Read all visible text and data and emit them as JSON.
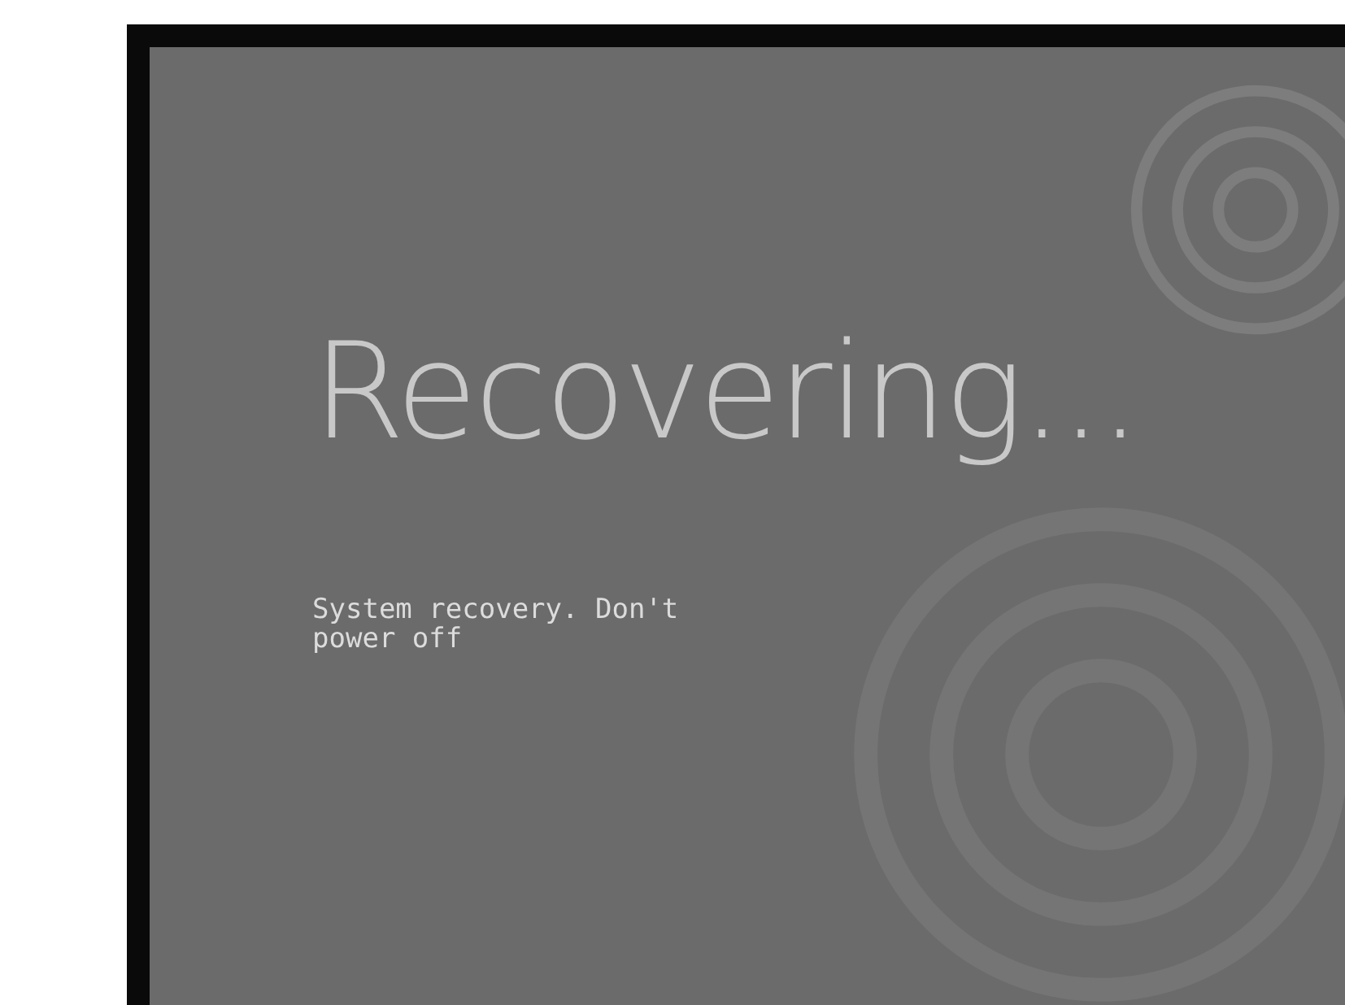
{
  "screen": {
    "title": "Recovering...",
    "message": "System recovery. Don't power off"
  }
}
